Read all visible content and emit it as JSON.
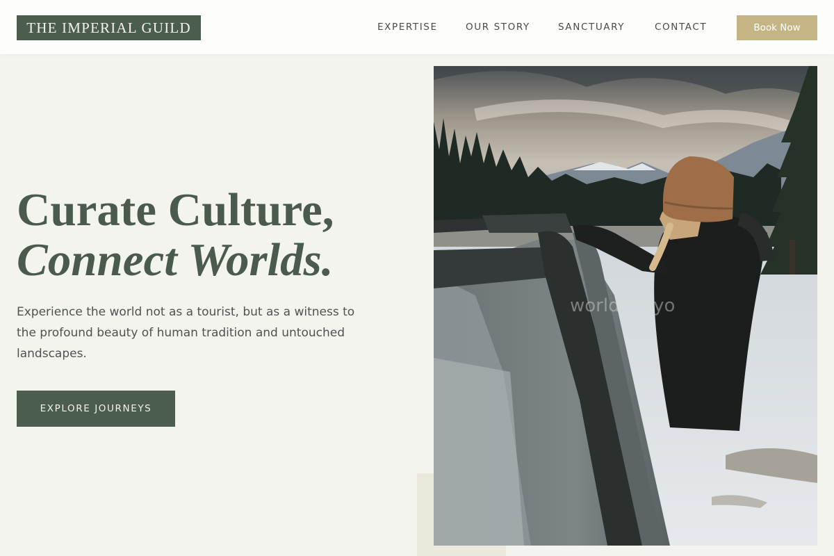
{
  "header": {
    "logo": "THE IMPERIAL GUILD",
    "nav": [
      "EXPERTISE",
      "OUR STORY",
      "SANCTUARY",
      "CONTACT"
    ],
    "cta": "Book Now"
  },
  "hero": {
    "headline_line1": "Curate Culture,",
    "headline_line2": "Connect Worlds.",
    "description": "Experience the world not as a tourist, but as a witness to the profound beauty of human tradition and untouched landscapes.",
    "cta": "EXPLORE JOURNEYS"
  },
  "image": {
    "watermark": "world.tokyo",
    "alt": "Woman in beanie leaning out of a car window in a snowy mountain forest"
  },
  "colors": {
    "primary": "#4b5e4e",
    "accent": "#c5b584",
    "background": "#f4f4ef"
  }
}
